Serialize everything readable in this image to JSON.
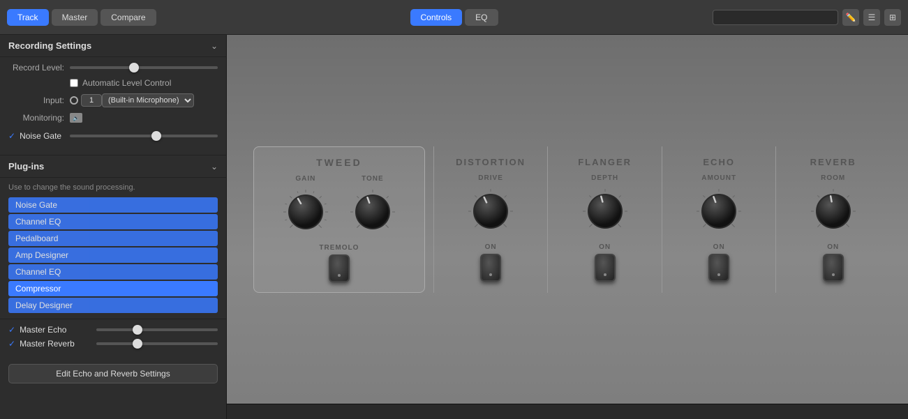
{
  "header": {
    "tabs_left": [
      "Track",
      "Master",
      "Compare"
    ],
    "active_tab_left": "Track",
    "tabs_center": [
      "Controls",
      "EQ"
    ],
    "active_tab_center": "Controls",
    "search_placeholder": "",
    "icons": [
      "pencil-icon",
      "list-icon",
      "grid-icon"
    ]
  },
  "left_panel": {
    "recording_settings": {
      "title": "Recording Settings",
      "record_level_label": "Record Level:",
      "auto_level_label": "Automatic Level Control",
      "input_label": "Input:",
      "input_number": "1",
      "input_device": "(Built-in Microphone)",
      "monitoring_label": "Monitoring:",
      "noise_gate_label": "Noise Gate"
    },
    "plugins": {
      "title": "Plug-ins",
      "help_text": "Use to change the sound processing.",
      "items": [
        {
          "label": "Noise Gate",
          "selected": false
        },
        {
          "label": "Channel EQ",
          "selected": false
        },
        {
          "label": "Pedalboard",
          "selected": false
        },
        {
          "label": "Amp Designer",
          "selected": false
        },
        {
          "label": "Channel EQ",
          "selected": false
        },
        {
          "label": "Compressor",
          "selected": true
        },
        {
          "label": "Delay Designer",
          "selected": false
        }
      ]
    },
    "master_echo": {
      "label": "Master Echo",
      "checked": true
    },
    "master_reverb": {
      "label": "Master Reverb",
      "checked": true
    },
    "edit_button_label": "Edit Echo and Reverb Settings"
  },
  "amp": {
    "sections": [
      {
        "title": "TWEED",
        "knobs": [
          {
            "label": "GAIN",
            "value": 6
          },
          {
            "label": "TONE",
            "value": 5
          }
        ],
        "extra": {
          "label": "TREMOLO"
        }
      },
      {
        "title": "DISTORTION",
        "knobs": [
          {
            "label": "DRIVE",
            "value": 5
          }
        ],
        "extra": {
          "label": "ON"
        }
      },
      {
        "title": "FLANGER",
        "knobs": [
          {
            "label": "DEPTH",
            "value": 5
          }
        ],
        "extra": {
          "label": "ON"
        }
      },
      {
        "title": "ECHO",
        "knobs": [
          {
            "label": "AMOUNT",
            "value": 5
          }
        ],
        "extra": {
          "label": "ON"
        }
      },
      {
        "title": "REVERB",
        "knobs": [
          {
            "label": "ROOM",
            "value": 5
          }
        ],
        "extra": {
          "label": "ON"
        }
      }
    ]
  }
}
